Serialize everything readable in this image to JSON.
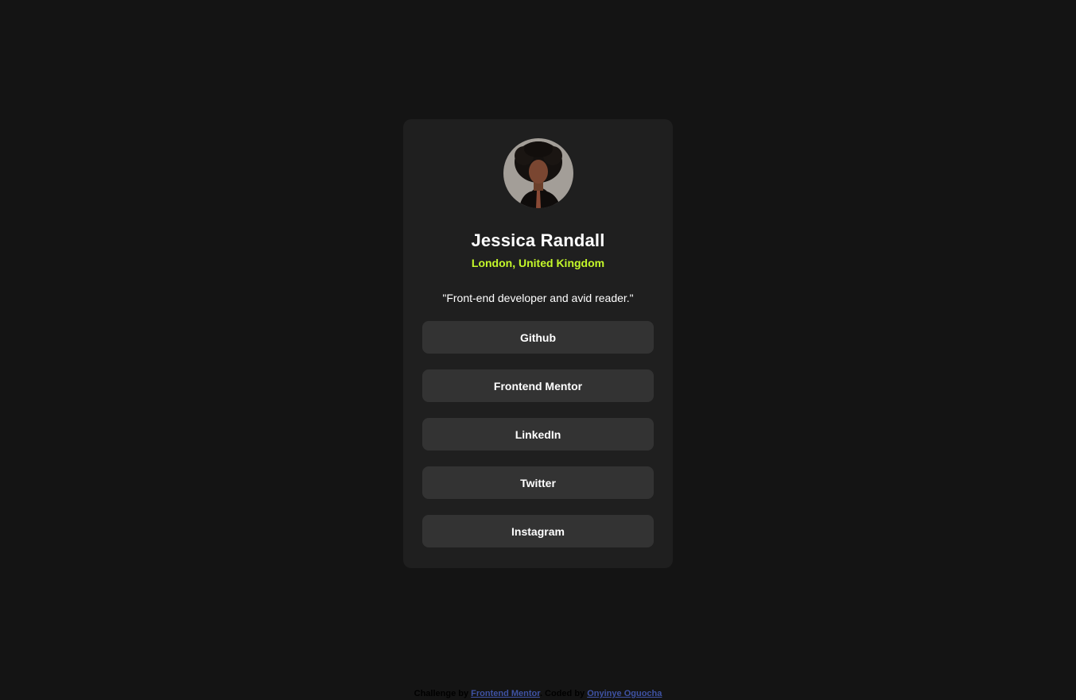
{
  "profile": {
    "name": "Jessica Randall",
    "location": "London, United Kingdom",
    "bio": "\"Front-end developer and avid reader.\""
  },
  "links": [
    {
      "label": "Github"
    },
    {
      "label": "Frontend Mentor"
    },
    {
      "label": "LinkedIn"
    },
    {
      "label": "Twitter"
    },
    {
      "label": "Instagram"
    }
  ],
  "footer": {
    "challenge_prefix": "Challenge by",
    "challenge_link": "Frontend Mentor",
    "coded_prefix": ". Coded by",
    "author_link": "Onyinye Oguocha"
  },
  "colors": {
    "background": "#141414",
    "card": "#1f1f1f",
    "button": "#333333",
    "accent": "#c4f82a",
    "footer_link": "#3e52a3"
  }
}
